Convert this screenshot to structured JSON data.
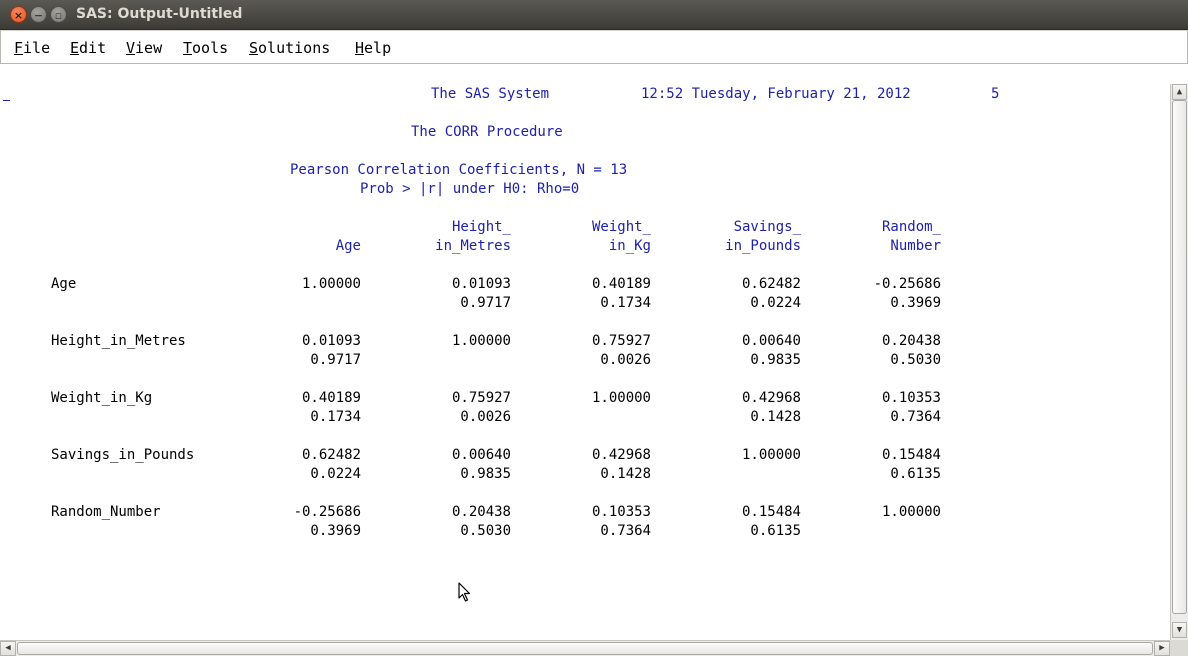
{
  "window": {
    "title": "SAS: Output-Untitled",
    "close_glyph": "×",
    "minimize_glyph": "−",
    "maximize_glyph": "▫"
  },
  "menu": [
    {
      "underline": "F",
      "rest": "ile"
    },
    {
      "underline": "E",
      "rest": "dit"
    },
    {
      "underline": "V",
      "rest": "iew"
    },
    {
      "underline": "T",
      "rest": "ools"
    },
    {
      "underline": "S",
      "rest": "olutions"
    },
    {
      "underline": "H",
      "rest": "elp"
    }
  ],
  "output": {
    "header": {
      "system": "The SAS System",
      "datetime": "12:52 Tuesday, February 21, 2012",
      "page": "5"
    },
    "procedure": "The CORR Procedure",
    "subtitle1": "Pearson Correlation Coefficients, N = 13",
    "subtitle2": "Prob > |r| under H0: Rho=0",
    "columns": [
      {
        "line1": "",
        "line2": "Age"
      },
      {
        "line1": "Height_",
        "line2": "in_Metres"
      },
      {
        "line1": "Weight_",
        "line2": "in_Kg"
      },
      {
        "line1": "Savings_",
        "line2": "in_Pounds"
      },
      {
        "line1": "Random_",
        "line2": "Number"
      }
    ],
    "rows": [
      {
        "label": "Age",
        "r": [
          "1.00000",
          "0.01093",
          "0.40189",
          "0.62482",
          "-0.25686"
        ],
        "p": [
          "",
          "0.9717",
          "0.1734",
          "0.0224",
          "0.3969"
        ]
      },
      {
        "label": "Height_in_Metres",
        "r": [
          "0.01093",
          "1.00000",
          "0.75927",
          "0.00640",
          "0.20438"
        ],
        "p": [
          "0.9717",
          "",
          "0.0026",
          "0.9835",
          "0.5030"
        ]
      },
      {
        "label": "Weight_in_Kg",
        "r": [
          "0.40189",
          "0.75927",
          "1.00000",
          "0.42968",
          "0.10353"
        ],
        "p": [
          "0.1734",
          "0.0026",
          "",
          "0.1428",
          "0.7364"
        ]
      },
      {
        "label": "Savings_in_Pounds",
        "r": [
          "0.62482",
          "0.00640",
          "0.42968",
          "1.00000",
          "0.15484"
        ],
        "p": [
          "0.0224",
          "0.9835",
          "0.1428",
          "",
          "0.6135"
        ]
      },
      {
        "label": "Random_Number",
        "r": [
          "-0.25686",
          "0.20438",
          "0.10353",
          "0.15484",
          "1.00000"
        ],
        "p": [
          "0.3969",
          "0.5030",
          "0.7364",
          "0.6135",
          ""
        ]
      }
    ]
  },
  "scrollbars": {
    "up_glyph": "▲",
    "down_glyph": "▼",
    "left_glyph": "◀",
    "right_glyph": "▶"
  },
  "colors": {
    "output_text": "#1e22a8",
    "data_text": "#000000",
    "titlebar": "#3c3b37"
  }
}
